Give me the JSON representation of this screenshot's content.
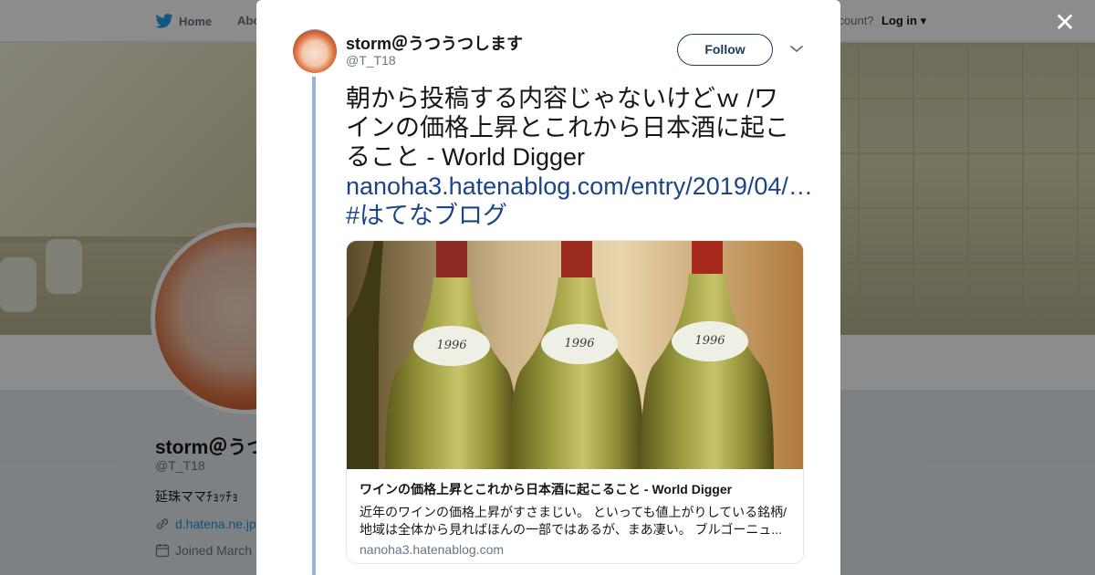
{
  "topbar": {
    "home_label": "Home",
    "about_label": "Abo",
    "account_text": "ccount?",
    "login_label": "Log in"
  },
  "profile_bg": {
    "name": "storm＠うつ",
    "handle": "@T_T18",
    "bio": "延珠ママﾁｮｯﾁｮ",
    "link": "d.hatena.ne.jp",
    "joined": "Joined March"
  },
  "modal": {
    "close_label": "✕",
    "tweet": {
      "name": "storm＠うつうつします",
      "handle": "@T_T18",
      "follow_label": "Follow",
      "text_plain": "朝から投稿する内容じゃないけどｗ /ワインの価格上昇とこれから日本酒に起こること - World Digger ",
      "link_text": "nanoha3.hatenablog.com/entry/2019/04/…",
      "hashtag": "#はてなブログ"
    },
    "card": {
      "title": "ワインの価格上昇とこれから日本酒に起こること - World Digger",
      "description": "近年のワインの価格上昇がすさまじい。 といっても値上がりしている銘柄/地域は全体から見ればほんの一部ではあるが、まあ凄い。 ブルゴーニュ...",
      "domain": "nanoha3.hatenablog.com",
      "image_labels": [
        "1996",
        "1996",
        "1996"
      ]
    }
  },
  "colors": {
    "accent": "#1c4587",
    "text": "#14171a",
    "muted": "#657786",
    "thread_line": "#9bb0cf",
    "twitter_blue": "#1da1f2"
  }
}
